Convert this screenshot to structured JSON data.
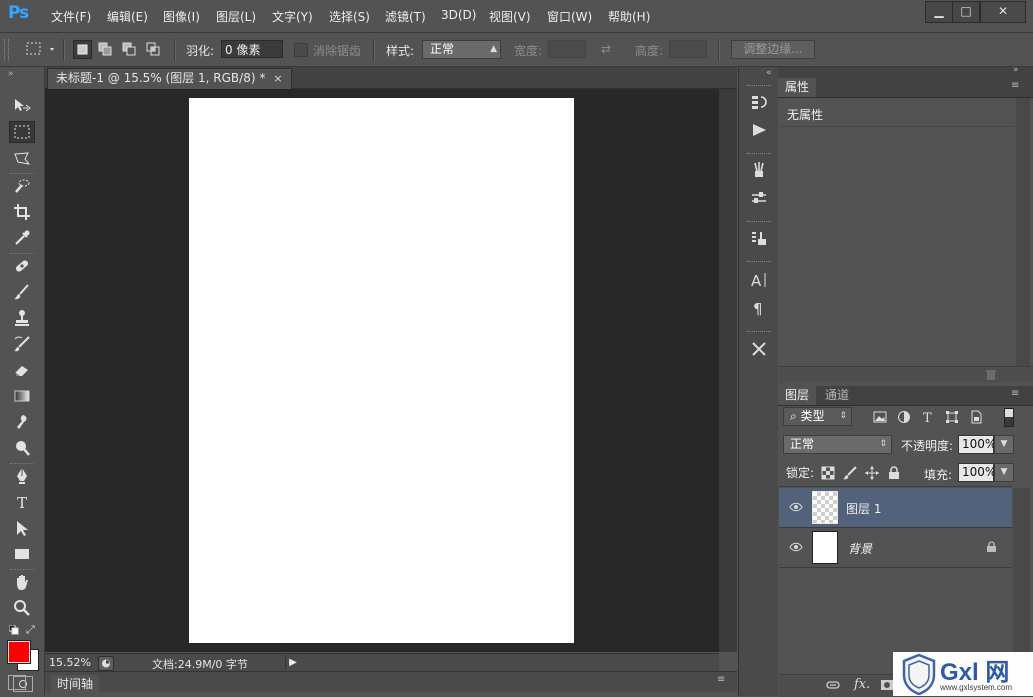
{
  "app": {
    "logo": "Ps"
  },
  "menu": [
    "文件(F)",
    "编辑(E)",
    "图像(I)",
    "图层(L)",
    "文字(Y)",
    "选择(S)",
    "滤镜(T)",
    "3D(D)",
    "视图(V)",
    "窗口(W)",
    "帮助(H)"
  ],
  "window_controls": {
    "minimize": "▁",
    "maximize": "□",
    "close": "✕"
  },
  "options": {
    "feather_label": "羽化:",
    "feather_value": "0 像素",
    "antialias_label": "消除锯齿",
    "style_label": "样式:",
    "style_value": "正常",
    "width_label": "宽度:",
    "height_label": "高度:",
    "refine_edge": "调整边缘..."
  },
  "document": {
    "tab_title": "未标题-1 @ 15.5% (图层 1, RGB/8) *",
    "tab_close": "×",
    "zoom": "15.52%",
    "doc_info": "文档:24.9M/0 字节"
  },
  "timeline": {
    "label": "时间轴"
  },
  "properties": {
    "tab": "属性",
    "empty_text": "无属性"
  },
  "layers_panel": {
    "tabs": [
      "图层",
      "通道"
    ],
    "filter_kind": "类型",
    "blend_mode": "正常",
    "opacity_label": "不透明度:",
    "opacity_value": "100%",
    "lock_label": "锁定:",
    "fill_label": "填充:",
    "fill_value": "100%",
    "layers": [
      {
        "name": "图层 1",
        "selected": true,
        "transparent": true,
        "locked": false
      },
      {
        "name": "背景",
        "selected": false,
        "transparent": false,
        "locked": true
      }
    ]
  },
  "colors": {
    "foreground": "#ff0000",
    "background": "#ffffff",
    "selected_layer": "#52627a",
    "accent": "#31a8ff"
  },
  "watermark": {
    "brand": "Gxl 网",
    "url": "www.gxlsystem.com"
  }
}
